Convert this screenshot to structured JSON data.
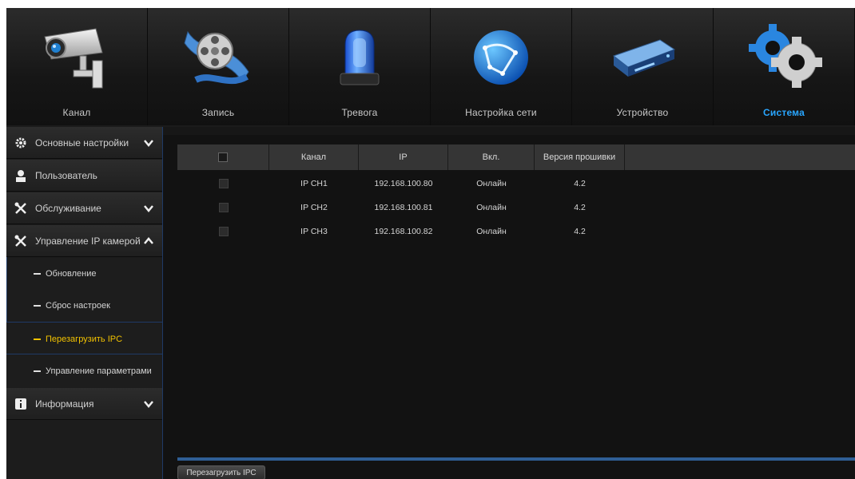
{
  "topnav": {
    "tabs": [
      {
        "label": "Канал",
        "icon": "camera-icon",
        "active": false
      },
      {
        "label": "Запись",
        "icon": "film-reel-icon",
        "active": false
      },
      {
        "label": "Тревога",
        "icon": "alarm-light-icon",
        "active": false
      },
      {
        "label": "Настройка сети",
        "icon": "network-globe-icon",
        "active": false
      },
      {
        "label": "Устройство",
        "icon": "hard-drive-icon",
        "active": false
      },
      {
        "label": "Система",
        "icon": "gears-icon",
        "active": true
      }
    ]
  },
  "sidebar": {
    "items": [
      {
        "label": "Основные настройки",
        "icon": "gear-icon",
        "chevron": "down"
      },
      {
        "label": "Пользователь",
        "icon": "user-icon",
        "chevron": "none"
      },
      {
        "label": "Обслуживание",
        "icon": "tools-icon",
        "chevron": "down"
      },
      {
        "label": "Управление IP камерой",
        "icon": "tools-icon",
        "chevron": "up"
      },
      {
        "label": "Информация",
        "icon": "info-icon",
        "chevron": "down"
      }
    ],
    "subitems": [
      {
        "label": "Обновление",
        "active": false
      },
      {
        "label": "Сброс настроек",
        "active": false
      },
      {
        "label": "Перезагрузить IPC",
        "active": true
      },
      {
        "label": "Управление параметрами",
        "active": false
      }
    ]
  },
  "table": {
    "columns": [
      "Канал",
      "IP",
      "Вкл.",
      "Версия прошивки"
    ],
    "rows": [
      {
        "channel": "IP CH1",
        "ip": "192.168.100.80",
        "status": "Онлайн",
        "firmware": "4.2"
      },
      {
        "channel": "IP CH2",
        "ip": "192.168.100.81",
        "status": "Онлайн",
        "firmware": "4.2"
      },
      {
        "channel": "IP CH3",
        "ip": "192.168.100.82",
        "status": "Онлайн",
        "firmware": "4.2"
      }
    ]
  },
  "actions": {
    "reboot_label": "Перезагрузить IPC"
  },
  "colors": {
    "accent": "#29a6ff",
    "active_subitem": "#f2c200",
    "border_blue": "#1f3a66"
  }
}
